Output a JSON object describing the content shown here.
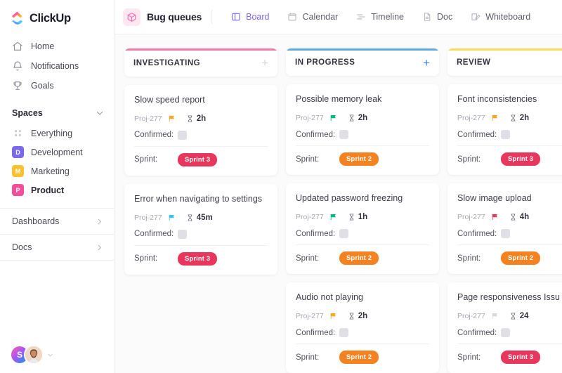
{
  "sidebar": {
    "brand": {
      "name": "ClickUp",
      "logo_icon": "clickup-logo-icon"
    },
    "nav": [
      {
        "label": "Home",
        "icon": "home-icon"
      },
      {
        "label": "Notifications",
        "icon": "bell-icon"
      },
      {
        "label": "Goals",
        "icon": "trophy-icon"
      }
    ],
    "spaces": {
      "title": "Spaces",
      "collapse_icon": "chevron-down-icon",
      "items": [
        {
          "label": "Everything",
          "icon": "grid-icon",
          "initial": "",
          "color": "",
          "active": false
        },
        {
          "label": "Development",
          "icon": "space-badge",
          "initial": "D",
          "color": "#7b68ee",
          "active": false
        },
        {
          "label": "Marketing",
          "icon": "space-badge",
          "initial": "M",
          "color": "#fbc02d",
          "active": false
        },
        {
          "label": "Product",
          "icon": "space-badge",
          "initial": "P",
          "color": "#f0509b",
          "active": true
        }
      ]
    },
    "footer_items": [
      {
        "label": "Dashboards",
        "icon": "chevron-right-icon"
      },
      {
        "label": "Docs",
        "icon": "chevron-right-icon"
      }
    ],
    "avatars": {
      "workspace_initial": "S",
      "user_avatar": "user-photo-avatar",
      "dropdown_icon": "chevron-down-icon"
    }
  },
  "topbar": {
    "list": {
      "name": "Bug queues",
      "icon": "cube-icon",
      "icon_color": "#f472b6"
    },
    "views": [
      {
        "label": "Board",
        "icon": "board-icon",
        "active": true
      },
      {
        "label": "Calendar",
        "icon": "calendar-icon",
        "active": false
      },
      {
        "label": "Timeline",
        "icon": "timeline-icon",
        "active": false
      },
      {
        "label": "Doc",
        "icon": "doc-icon",
        "active": false
      },
      {
        "label": "Whiteboard",
        "icon": "whiteboard-icon",
        "active": false
      }
    ]
  },
  "board": {
    "field_labels": {
      "confirmed": "Confirmed:",
      "sprint": "Sprint:"
    },
    "add_label": "+",
    "columns": [
      {
        "title": "INVESTIGATING",
        "bar_color": "#f07ba5",
        "plus_color": "#d6d6de",
        "cards": [
          {
            "title": "Slow speed report",
            "project": "Proj-277",
            "flag_color": "#f5a623",
            "time": "2h",
            "confirmed": "",
            "sprint": "Sprint 3",
            "sprint_color": "#e8365d"
          },
          {
            "title": "Error when navigating to settings",
            "project": "Proj-277",
            "flag_color": "#36c5f0",
            "time": "45m",
            "confirmed": "",
            "sprint": "Sprint 3",
            "sprint_color": "#e8365d"
          }
        ]
      },
      {
        "title": "IN PROGRESS",
        "bar_color": "#5ea9e8",
        "plus_color": "#2f80ed",
        "cards": [
          {
            "title": "Possible memory leak",
            "project": "Proj-277",
            "flag_color": "#00b884",
            "time": "2h",
            "confirmed": "",
            "sprint": "Sprint 2",
            "sprint_color": "#f58220"
          },
          {
            "title": "Updated password freezing",
            "project": "Proj-277",
            "flag_color": "#00b884",
            "time": "1h",
            "confirmed": "",
            "sprint": "Sprint 2",
            "sprint_color": "#f58220"
          },
          {
            "title": "Audio not playing",
            "project": "Proj-277",
            "flag_color": "#f5a623",
            "time": "2h",
            "confirmed": "",
            "sprint": "Sprint 2",
            "sprint_color": "#f58220"
          }
        ]
      },
      {
        "title": "REVIEW",
        "bar_color": "#f7dd5c",
        "plus_color": "#d6d6de",
        "cards": [
          {
            "title": "Font inconsistencies",
            "project": "Proj-277",
            "flag_color": "#f5a623",
            "time": "2h",
            "confirmed": "",
            "sprint": "Sprint 3",
            "sprint_color": "#e8365d"
          },
          {
            "title": "Slow image upload",
            "project": "Proj-277",
            "flag_color": "#e8365d",
            "time": "4h",
            "confirmed": "",
            "sprint": "Sprint 2",
            "sprint_color": "#f58220"
          },
          {
            "title": "Page responsiveness Issu",
            "project": "Proj-277",
            "flag_color": "#d8d8e0",
            "time": "24",
            "confirmed": "",
            "sprint": "Sprint 3",
            "sprint_color": "#e8365d"
          }
        ]
      }
    ]
  }
}
